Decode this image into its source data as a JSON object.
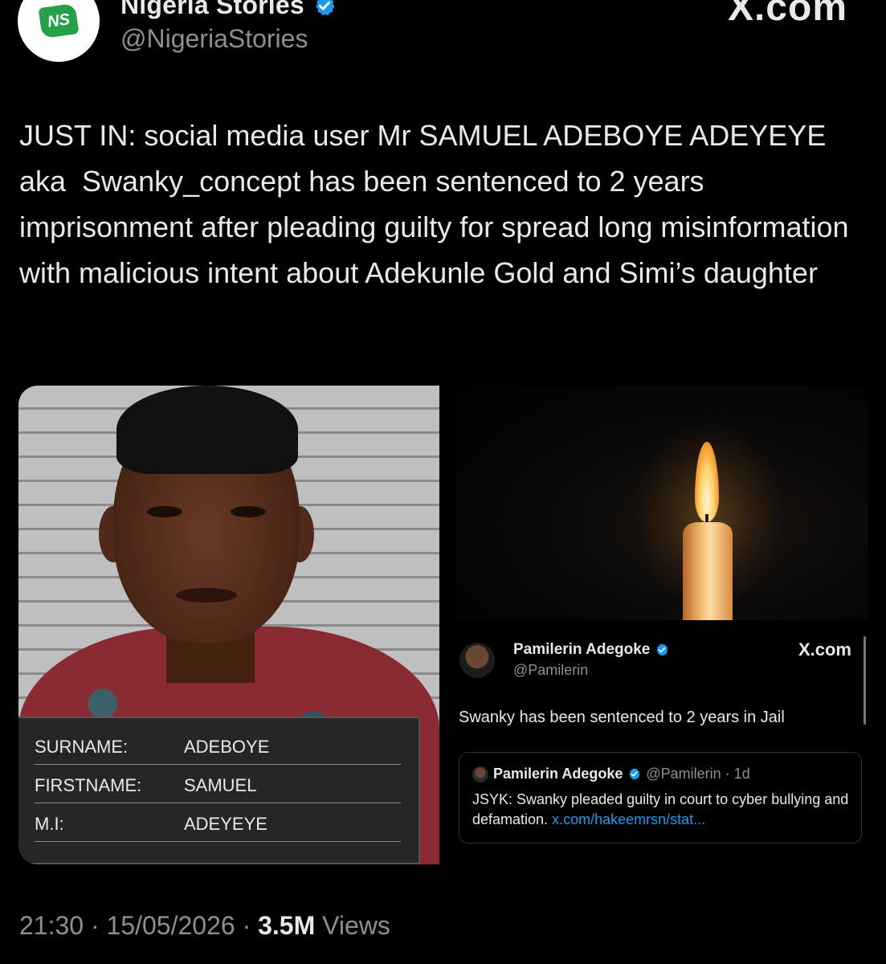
{
  "account": {
    "display_name": "Nigeria Stories",
    "handle": "@NigeriaStories",
    "logo_text": "NS",
    "logo_tagline": "Nigeria Stories",
    "verified_icon": "verified-badge-icon",
    "source": "X.com"
  },
  "tweet": {
    "text": "JUST IN: social media user Mr SAMUEL ADEBOYE ADEYEYE aka  Swanky_concept has been sentenced to 2 years imprisonment after pleading guilty for spread long misinformation with malicious intent about Adekunle Gold and Simi’s daughter"
  },
  "mugshot_board": {
    "rows": [
      {
        "label": "SURNAME:",
        "value": "ADEBOYE"
      },
      {
        "label": "FIRSTNAME:",
        "value": "SAMUEL"
      },
      {
        "label": "M.I:",
        "value": "ADEYEYE"
      }
    ]
  },
  "embedded_post": {
    "display_name": "Pamilerin Adegoke",
    "handle": "@Pamilerin",
    "source": "X.com",
    "text": "Swanky has been sentenced to 2 years in Jail",
    "quote": {
      "display_name": "Pamilerin Adegoke",
      "meta": "@Pamilerin · 1d",
      "body": "JSYK: Swanky pleaded guilty in court to cyber bullying and defamation. ",
      "link": "x.com/hakeemrsn/stat..."
    }
  },
  "footer": {
    "time": "21:30",
    "separator": " · ",
    "date": "15/05/2026",
    "views_count": "3.5M",
    "views_label": " Views"
  },
  "colors": {
    "background": "#000000",
    "text": "#e7e9ea",
    "muted": "#8b9096",
    "verified": "#1d9bf0",
    "link": "#1d9bf0",
    "logo_green": "#24a148"
  }
}
